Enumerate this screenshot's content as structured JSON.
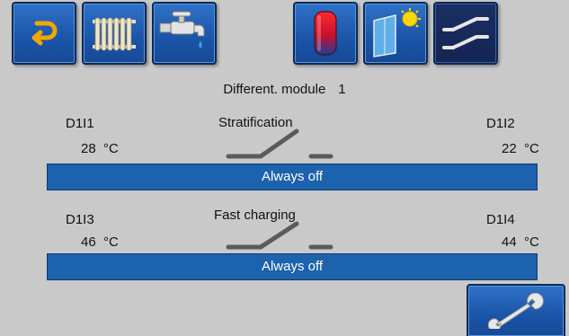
{
  "toolbar": {
    "buttons": [
      {
        "name": "back-icon"
      },
      {
        "name": "radiator-icon"
      },
      {
        "name": "water-tap-icon"
      },
      {
        "name": "buffer-tank-icon"
      },
      {
        "name": "solar-icon"
      },
      {
        "name": "differential-switch-icon",
        "active": true
      }
    ]
  },
  "module": {
    "label": "Different. module",
    "number": "1"
  },
  "circuits": [
    {
      "name": "Stratification",
      "left": {
        "label": "D1I1",
        "temp": "28",
        "unit": "°C"
      },
      "right": {
        "label": "D1I2",
        "temp": "22",
        "unit": "°C"
      },
      "mode": "Always off"
    },
    {
      "name": "Fast charging",
      "left": {
        "label": "D1I3",
        "temp": "46",
        "unit": "°C"
      },
      "right": {
        "label": "D1I4",
        "temp": "44",
        "unit": "°C"
      },
      "mode": "Always off"
    }
  ],
  "colors": {
    "accent": "#1d62ad",
    "background": "#c9c9c9"
  }
}
